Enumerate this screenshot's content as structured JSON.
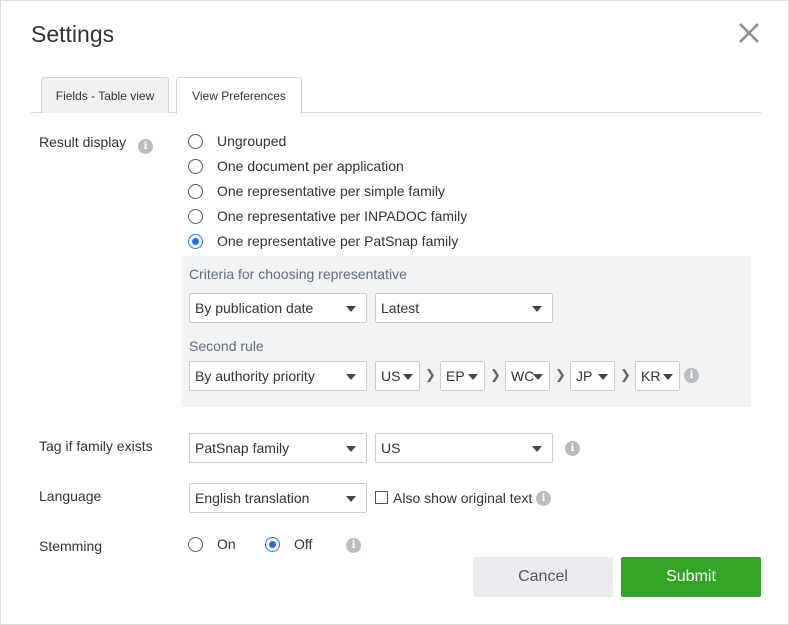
{
  "dialog": {
    "title": "Settings"
  },
  "tabs": [
    {
      "label": "Fields - Table view",
      "active": false
    },
    {
      "label": "View Preferences",
      "active": true
    }
  ],
  "result_display": {
    "label": "Result display",
    "options": [
      {
        "label": "Ungrouped",
        "checked": false
      },
      {
        "label": "One document per application",
        "checked": false
      },
      {
        "label": "One representative per simple family",
        "checked": false
      },
      {
        "label": "One representative per INPADOC family",
        "checked": false
      },
      {
        "label": "One representative per PatSnap family",
        "checked": true
      }
    ]
  },
  "criteria": {
    "label": "Criteria for choosing representative",
    "by_select": "By publication date",
    "order_select": "Latest",
    "second_rule_label": "Second rule",
    "second_rule_select": "By authority priority",
    "authorities": [
      "US",
      "EP",
      "WC",
      "JP",
      "KR"
    ]
  },
  "tag_family": {
    "label": "Tag if family exists",
    "family_select": "PatSnap family",
    "country_select": "US"
  },
  "language": {
    "label": "Language",
    "select": "English translation",
    "also_show_label": "Also show original text",
    "also_show_checked": false
  },
  "stemming": {
    "label": "Stemming",
    "on_label": "On",
    "off_label": "Off",
    "selected": "Off"
  },
  "buttons": {
    "cancel": "Cancel",
    "submit": "Submit"
  },
  "colors": {
    "accent": "#1a73e8",
    "submit": "#34a427",
    "panel": "#f2f3f5"
  }
}
